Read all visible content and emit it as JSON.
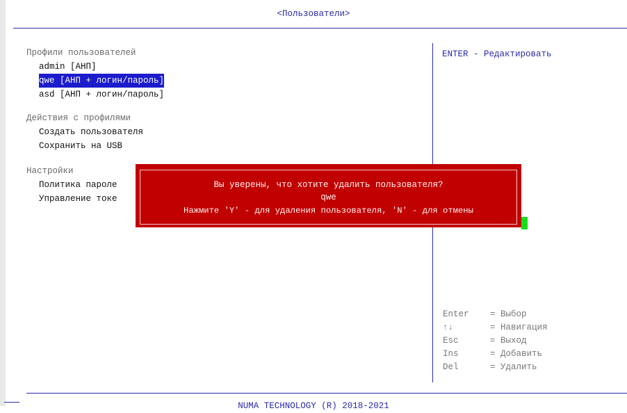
{
  "screen_title": "<Пользователи>",
  "left_panel": {
    "profiles_heading": "Профили пользователей",
    "profiles": [
      "admin [АНП]",
      "qwe [АНП + логин/пароль]",
      "asd [АНП + логин/пароль]"
    ],
    "actions_heading": "Действия с профилями",
    "actions": [
      "Создать пользователя",
      "Сохранить на USB"
    ],
    "settings_heading": "Настройки",
    "settings": [
      "Политика пароле",
      "Управление токе"
    ]
  },
  "right_panel": {
    "hint": "ENTER - Редактировать",
    "keys": [
      {
        "key": "Enter",
        "desc": "= Выбор"
      },
      {
        "key": "↑↓",
        "desc": "= Навигация"
      },
      {
        "key": "Esc",
        "desc": "= Выход"
      },
      {
        "key": "Ins",
        "desc": "= Добавить"
      },
      {
        "key": "Del",
        "desc": "= Удалить"
      }
    ]
  },
  "dialog": {
    "question": "Вы уверены, что хотите удалить пользователя?",
    "username": "qwe",
    "instructions": "Нажмите 'Y' - для удаления пользователя, 'N' - для отмены"
  },
  "footer": "NUMA TECHNOLOGY (R) 2018-2021",
  "colors": {
    "accent": "#2a2aa8",
    "selection": "#1c1ccc",
    "dialog_bg": "#c10000",
    "cursor": "#19dd19"
  }
}
